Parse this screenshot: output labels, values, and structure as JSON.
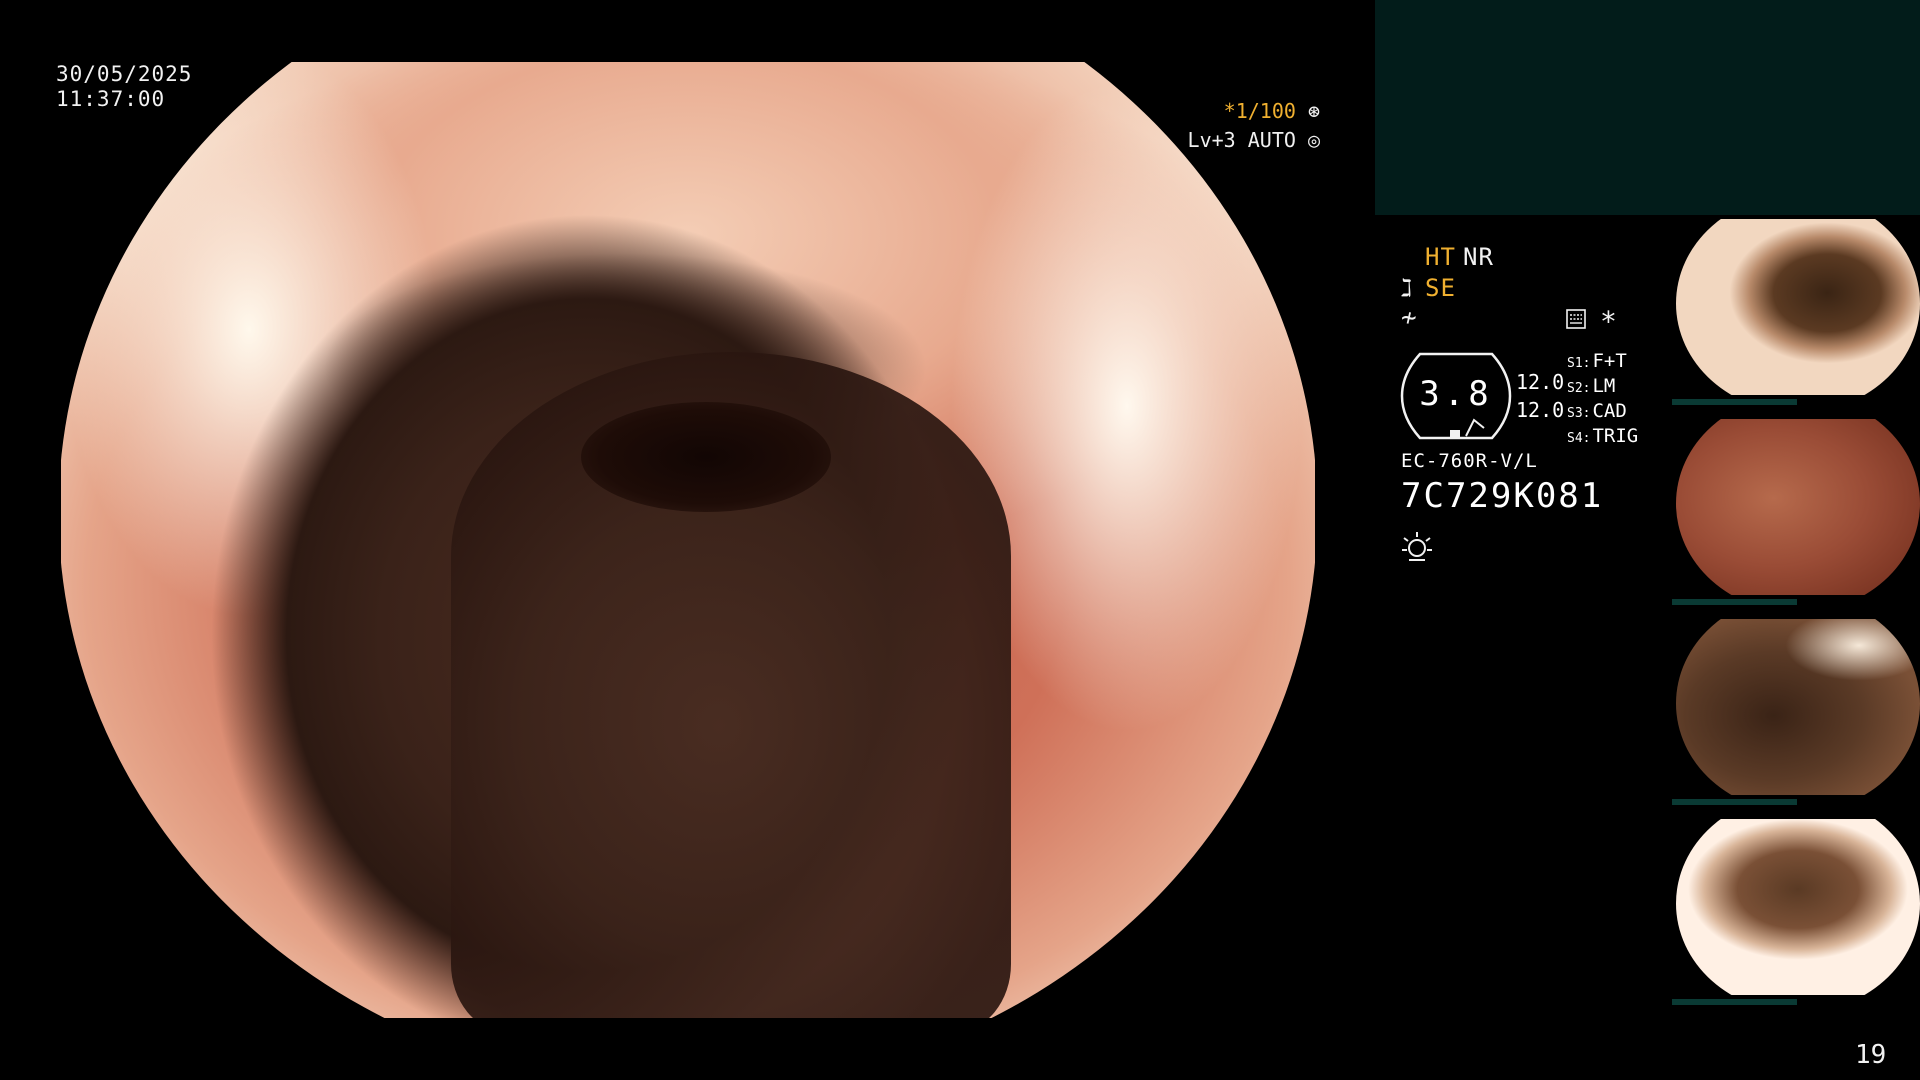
{
  "overlay": {
    "date": "30/05/2025",
    "time": "11:37:00",
    "enhancement": "*1/100",
    "level": "Lv+3 AUTO"
  },
  "status": {
    "ht": "HT",
    "nr": "NR",
    "se": "SE"
  },
  "gauge": {
    "value": "3.8",
    "val_a": "12.0",
    "val_b": "12.0"
  },
  "switches": [
    {
      "key": "S1:",
      "label": "F+T"
    },
    {
      "key": "S2:",
      "label": "LM"
    },
    {
      "key": "S3:",
      "label": "CAD"
    },
    {
      "key": "S4:",
      "label": "TRIG"
    }
  ],
  "scope": {
    "model": "EC-760R-V/L",
    "serial": "7C729K081"
  },
  "icons": {
    "enhancement_icon": "aperture-icon",
    "level_icon": "iris-icon",
    "se_icon": "scope-icon",
    "freeze_icon": "freeze-icon",
    "keyboard_icon": "keyboard-icon",
    "star_icon": "star-icon",
    "light_icon": "light-icon"
  },
  "colors": {
    "accent": "#f0b030",
    "top_panel": "#021c1a"
  },
  "page_number": "19"
}
